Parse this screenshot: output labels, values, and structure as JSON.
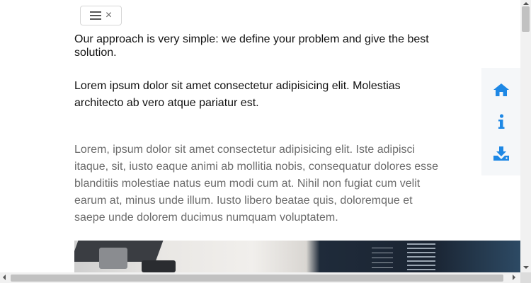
{
  "toggle": {
    "menu_icon": "hamburger-icon",
    "close_glyph": "×"
  },
  "content": {
    "paragraph_1": "Our approach is very simple: we define your problem and give the best solution.",
    "paragraph_2": "Lorem ipsum dolor sit amet consectetur adipisicing elit. Molestias architecto ab vero atque pariatur est.",
    "paragraph_3": "Lorem, ipsum dolor sit amet consectetur adipisicing elit. Iste adipisci itaque, sit, iusto eaque animi ab mollitia nobis, consequatur dolores esse blanditiis molestiae natus eum modi cum at. Nihil non fugiat cum velit earum at, minus unde illum. Iusto libero beatae quis, doloremque et saepe unde dolorem ducimus numquam voluptatem."
  },
  "side_nav": {
    "items": [
      {
        "icon": "home-icon"
      },
      {
        "icon": "info-icon"
      },
      {
        "icon": "download-icon"
      }
    ],
    "accent_color": "#1e88e5"
  },
  "colors": {
    "body_text": "#111111",
    "muted_text": "#6b6b6b",
    "side_nav_bg": "#f5f7f9"
  }
}
